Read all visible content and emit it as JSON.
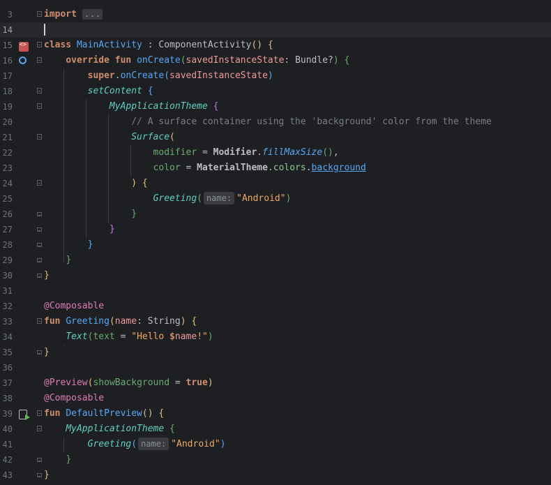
{
  "editor": {
    "lines": [
      {
        "n": "3"
      },
      {
        "n": "14"
      },
      {
        "n": "15"
      },
      {
        "n": "16"
      },
      {
        "n": "17"
      },
      {
        "n": "18"
      },
      {
        "n": "19"
      },
      {
        "n": "20"
      },
      {
        "n": "21"
      },
      {
        "n": "22"
      },
      {
        "n": "23"
      },
      {
        "n": "24"
      },
      {
        "n": "25"
      },
      {
        "n": "26"
      },
      {
        "n": "27"
      },
      {
        "n": "28"
      },
      {
        "n": "29"
      },
      {
        "n": "30"
      },
      {
        "n": "31"
      },
      {
        "n": "32"
      },
      {
        "n": "33"
      },
      {
        "n": "34"
      },
      {
        "n": "35"
      },
      {
        "n": "36"
      },
      {
        "n": "37"
      },
      {
        "n": "38"
      },
      {
        "n": "39"
      },
      {
        "n": "40"
      },
      {
        "n": "41"
      },
      {
        "n": "42"
      },
      {
        "n": "43"
      }
    ],
    "tokens": {
      "import_kw": "import",
      "import_fold": "...",
      "class_kw": "class",
      "class_name": "MainActivity",
      "colon": " : ",
      "super_class": "ComponentActivity",
      "override_kw": "override fun",
      "oncreate_fn": "onCreate",
      "param_saved": "savedInstanceState",
      "bundle_type": "Bundle?",
      "super_kw": "super",
      "setcontent_fn": "setContent",
      "theme_fn": "MyApplicationTheme",
      "comment_surface": "// A surface container using the 'background' color from the theme",
      "surface_fn": "Surface",
      "modifier_param": "modifier",
      "modifier_obj": "Modifier",
      "fillmax_fn": "fillMaxSize",
      "color_param": "color",
      "materialtheme_obj": "MaterialTheme",
      "colors_prop": "colors",
      "background_prop": "background",
      "greeting_fn": "Greeting",
      "hint_name": "name:",
      "android_str": "\"Android\"",
      "composable_ann": "@Composable",
      "fun_kw": "fun",
      "name_param": "name",
      "string_type": "String",
      "text_fn": "Text",
      "text_param": "text",
      "hello_str_a": "\"Hello ",
      "hello_dollar": "$",
      "hello_name": "name",
      "hello_str_b": "!\"",
      "preview_ann": "@Preview",
      "showbg_param": "showBackground",
      "true_kw": "true",
      "defaultpreview_fn": "DefaultPreview"
    }
  }
}
